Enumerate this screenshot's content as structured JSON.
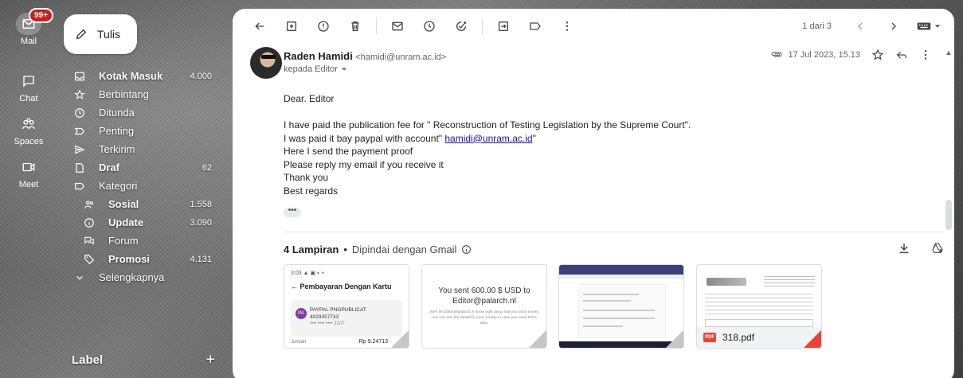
{
  "rail": {
    "badge": "99+",
    "items": [
      {
        "label": "Mail",
        "icon": "mail-icon"
      },
      {
        "label": "Chat",
        "icon": "chat-icon"
      },
      {
        "label": "Spaces",
        "icon": "spaces-icon"
      },
      {
        "label": "Meet",
        "icon": "meet-icon"
      }
    ]
  },
  "compose": {
    "label": "Tulis",
    "icon": "pencil-icon"
  },
  "nav": [
    {
      "label": "Kotak Masuk",
      "count": "4.000",
      "bold": true,
      "icon": "inbox-icon"
    },
    {
      "label": "Berbintang",
      "count": "",
      "bold": false,
      "icon": "star-icon"
    },
    {
      "label": "Ditunda",
      "count": "",
      "bold": false,
      "icon": "clock-icon"
    },
    {
      "label": "Penting",
      "count": "",
      "bold": false,
      "icon": "label-icon"
    },
    {
      "label": "Terkirim",
      "count": "",
      "bold": false,
      "icon": "send-icon"
    },
    {
      "label": "Draf",
      "count": "62",
      "bold": true,
      "icon": "draft-icon"
    },
    {
      "label": "Kategori",
      "count": "",
      "bold": false,
      "icon": "category-icon"
    },
    {
      "label": "Sosial",
      "count": "1.558",
      "bold": true,
      "icon": "people-icon",
      "sub": true
    },
    {
      "label": "Update",
      "count": "3.090",
      "bold": true,
      "icon": "info-icon",
      "sub": true
    },
    {
      "label": "Forum",
      "count": "",
      "bold": false,
      "icon": "forum-icon",
      "sub": true
    },
    {
      "label": "Promosi",
      "count": "4.131",
      "bold": true,
      "icon": "tag-icon",
      "sub": true
    },
    {
      "label": "Selengkapnya",
      "count": "",
      "bold": false,
      "icon": "chevron-down-icon"
    }
  ],
  "labels": {
    "title": "Label",
    "add": "+"
  },
  "toolbar": {
    "pager": "1 dari 3"
  },
  "email": {
    "sender_name": "Raden Hamidi",
    "sender_addr": "<hamidi@unram.ac.id>",
    "to": "kepada Editor",
    "date": "17 Jul 2023, 15.13",
    "greeting": "Dear. Editor",
    "line1": "I have paid the publication fee for \" Reconstruction of Testing Legislation by the Supreme Court\".",
    "line2_pre": "I was paid it bay paypal with account\" ",
    "line2_link": "hamidi@unram.ac.id",
    "line2_post": "\"",
    "line3": "Here I send the payment proof",
    "line4": "Please reply my email if you receive it",
    "line5": "Thank you",
    "line6": "Best regards",
    "more": "•••"
  },
  "attachments": {
    "count_label": "4 Lampiran",
    "sep": "•",
    "scan_label": "Dipindai dengan Gmail",
    "a1": {
      "status": "3:03 ▲ ▣ ◐ •",
      "title": "Pembayaran Dengan Kartu",
      "line1": "PAYPAL PNGPUBLICAT",
      "line2": "4029357733",
      "line3": "•••• •••• •••• 3107",
      "foot_left": "Jumlah",
      "foot_right": "Rp 9.24713"
    },
    "a2": {
      "main1": "You sent 600.00 $ USD to",
      "main2": "Editor@palarch.nl",
      "sub": "We'll let Editor@palarch.nl know right away that you sent money. You can see the details in your Activity in case you need them later."
    },
    "a4": {
      "filename": "318.pdf",
      "pdf": "PDF"
    }
  },
  "colors": {
    "badge": "#c5221f",
    "link": "#1a0dab",
    "pdf": "#ea4335"
  }
}
